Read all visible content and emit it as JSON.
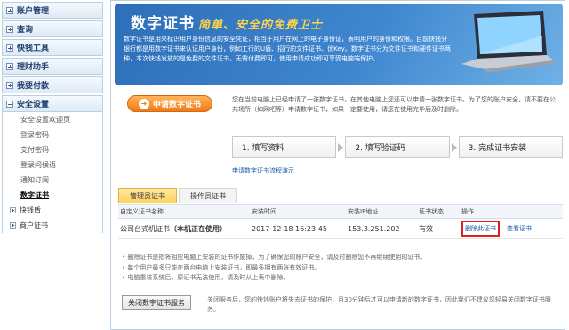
{
  "sidebar": {
    "sections": [
      {
        "label": "账户管理"
      },
      {
        "label": "查询"
      },
      {
        "label": "快钱工具"
      },
      {
        "label": "理财助手"
      },
      {
        "label": "我要付款"
      },
      {
        "label": "安全设置"
      }
    ],
    "security_items": [
      {
        "label": "安全设置欢迎页"
      },
      {
        "label": "登录密码"
      },
      {
        "label": "支付密码"
      },
      {
        "label": "登录问候语"
      },
      {
        "label": "通知订阅"
      },
      {
        "label": "数字证书"
      }
    ],
    "groups": [
      {
        "label": "快钱盾"
      },
      {
        "label": "商户证书"
      }
    ]
  },
  "banner": {
    "title": "数字证书",
    "slogan": "简单、安全的免费卫士",
    "description": "数字证书是用来标识用户身份信息的安全凭证，相当于用户在网上的电子身份证，表明用户的身份和权限。目前快钱分银行都是用数字证书来认证用户身份，例如工行的U盾、招行的文件证书、优Key。数字证书分为文件证书和硬件证书两种，本次快钱发放的是免费的文件证书，无需付费即可，使用申请成功即可享受电脑端保护。"
  },
  "apply": {
    "button_label": "申请数字证书",
    "text": "您在当前电脑上已经申请了一张数字证书，在其他电脑上您还可以申请一张数字证书。为了您的账户安全，请不要在公共场所（如网吧等）申请数字证书，如果一定要使用，请您在使用完毕后及时删除。"
  },
  "steps": [
    {
      "label": "1. 填写资料"
    },
    {
      "label": "2. 填写验证码"
    },
    {
      "label": "3. 完成证书安装"
    }
  ],
  "flow_link": "申请数字证书流程演示",
  "tabs": [
    {
      "label": "管理员证书"
    },
    {
      "label": "操作员证书"
    }
  ],
  "table": {
    "headers": [
      "自定义证书名称",
      "安装时间",
      "安装IP地址",
      "证书状态",
      "操作"
    ],
    "rows": [
      {
        "name": "公司台式机证书",
        "name_note": "（本机正在使用）",
        "time": "2017-12-18 16:23:45",
        "ip": "153.3.251.202",
        "status": "有效",
        "delete_label": "删除此证书",
        "view_label": "查看证书"
      }
    ]
  },
  "notes": [
    "删除证书是指将相应电脑上安装的证书作废掉，为了确保您的账户安全，请及时删除您不再继续使用的证书。",
    "每个用户最多只能在两台电脑上安装证书，即最多拥有两张有效证书。",
    "电脑重装系统后，原证书无法使用，请及时从上表中删除。"
  ],
  "close": {
    "button_label": "关闭数字证书服务",
    "text": "关闭服务后，您的快钱账户将失去证书的保护，且30分钟后才可以申请新的数字证书，因此我们不建议您轻易关闭数字证书服务。"
  }
}
